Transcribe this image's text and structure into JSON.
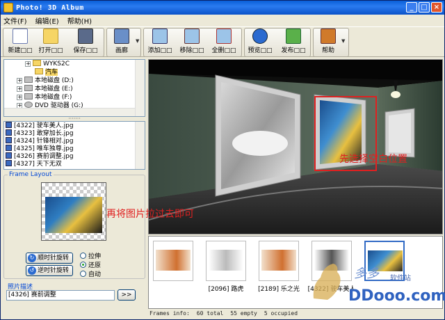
{
  "window": {
    "title": "Photo! 3D Album"
  },
  "menu": [
    "文件(F)",
    "编辑(E)",
    "帮助(H)"
  ],
  "toolbar": {
    "new": "新建□□",
    "open": "打开□□",
    "save": "保存□□",
    "view": "画廊",
    "add": "添加□□",
    "remove": "移除□□",
    "all": "全删□□",
    "preview": "预览□□",
    "publish": "发布□□",
    "help": "帮助"
  },
  "tree": {
    "items": [
      {
        "label": "WYKS2C",
        "indent": 2,
        "type": "folder"
      },
      {
        "label": "汽车",
        "indent": 3,
        "type": "folder",
        "selected": true
      },
      {
        "label": "本地磁盘 (D:)",
        "indent": 1,
        "type": "drive"
      },
      {
        "label": "本地磁盘 (E:)",
        "indent": 1,
        "type": "drive"
      },
      {
        "label": "本地磁盘 (F:)",
        "indent": 1,
        "type": "drive"
      },
      {
        "label": "DVD 驱动器 (G:)",
        "indent": 1,
        "type": "drive"
      }
    ]
  },
  "files": [
    "[4322] 驶车美人.jpg",
    "[4323] 敢穿加长.jpg",
    "[4324] 针锋相对.jpg",
    "[4325] 唯车独尊.jpg",
    "[4326] 赛前调整.jpg",
    "[4327] 天下无双"
  ],
  "frame_layout": {
    "legend": "Frame Layout",
    "rotate_cw": "顺时针旋转",
    "rotate_ccw": "逆时针旋转",
    "radio_stretch": "拉伸",
    "radio_restore": "还原",
    "radio_auto": "自动",
    "selected_radio": "还原"
  },
  "photo_desc": {
    "legend": "照片描述",
    "value": "[4326] 赛前调整",
    "button": ">>"
  },
  "viewport": {
    "hint_select": "先选择空白位置",
    "hint_drag": "再将图片拉过去即可"
  },
  "thumbnails": [
    {
      "label": ""
    },
    {
      "label": "[2096] 路虎"
    },
    {
      "label": "[2189] 乐之光"
    },
    {
      "label": "[4322] 驶车美人"
    },
    {
      "label": ""
    }
  ],
  "status": {
    "frames_info": "Frames info:",
    "total": "60 total",
    "empty": "55 empty",
    "occupied": "5 occupied"
  },
  "watermark": {
    "brand_cn": "多多",
    "brand_tag": "软件站",
    "brand_url": "DDooo.com"
  },
  "colors": {
    "titlebar": "#0a5fd8",
    "hint": "#e02020",
    "highlight": "#e02020"
  }
}
